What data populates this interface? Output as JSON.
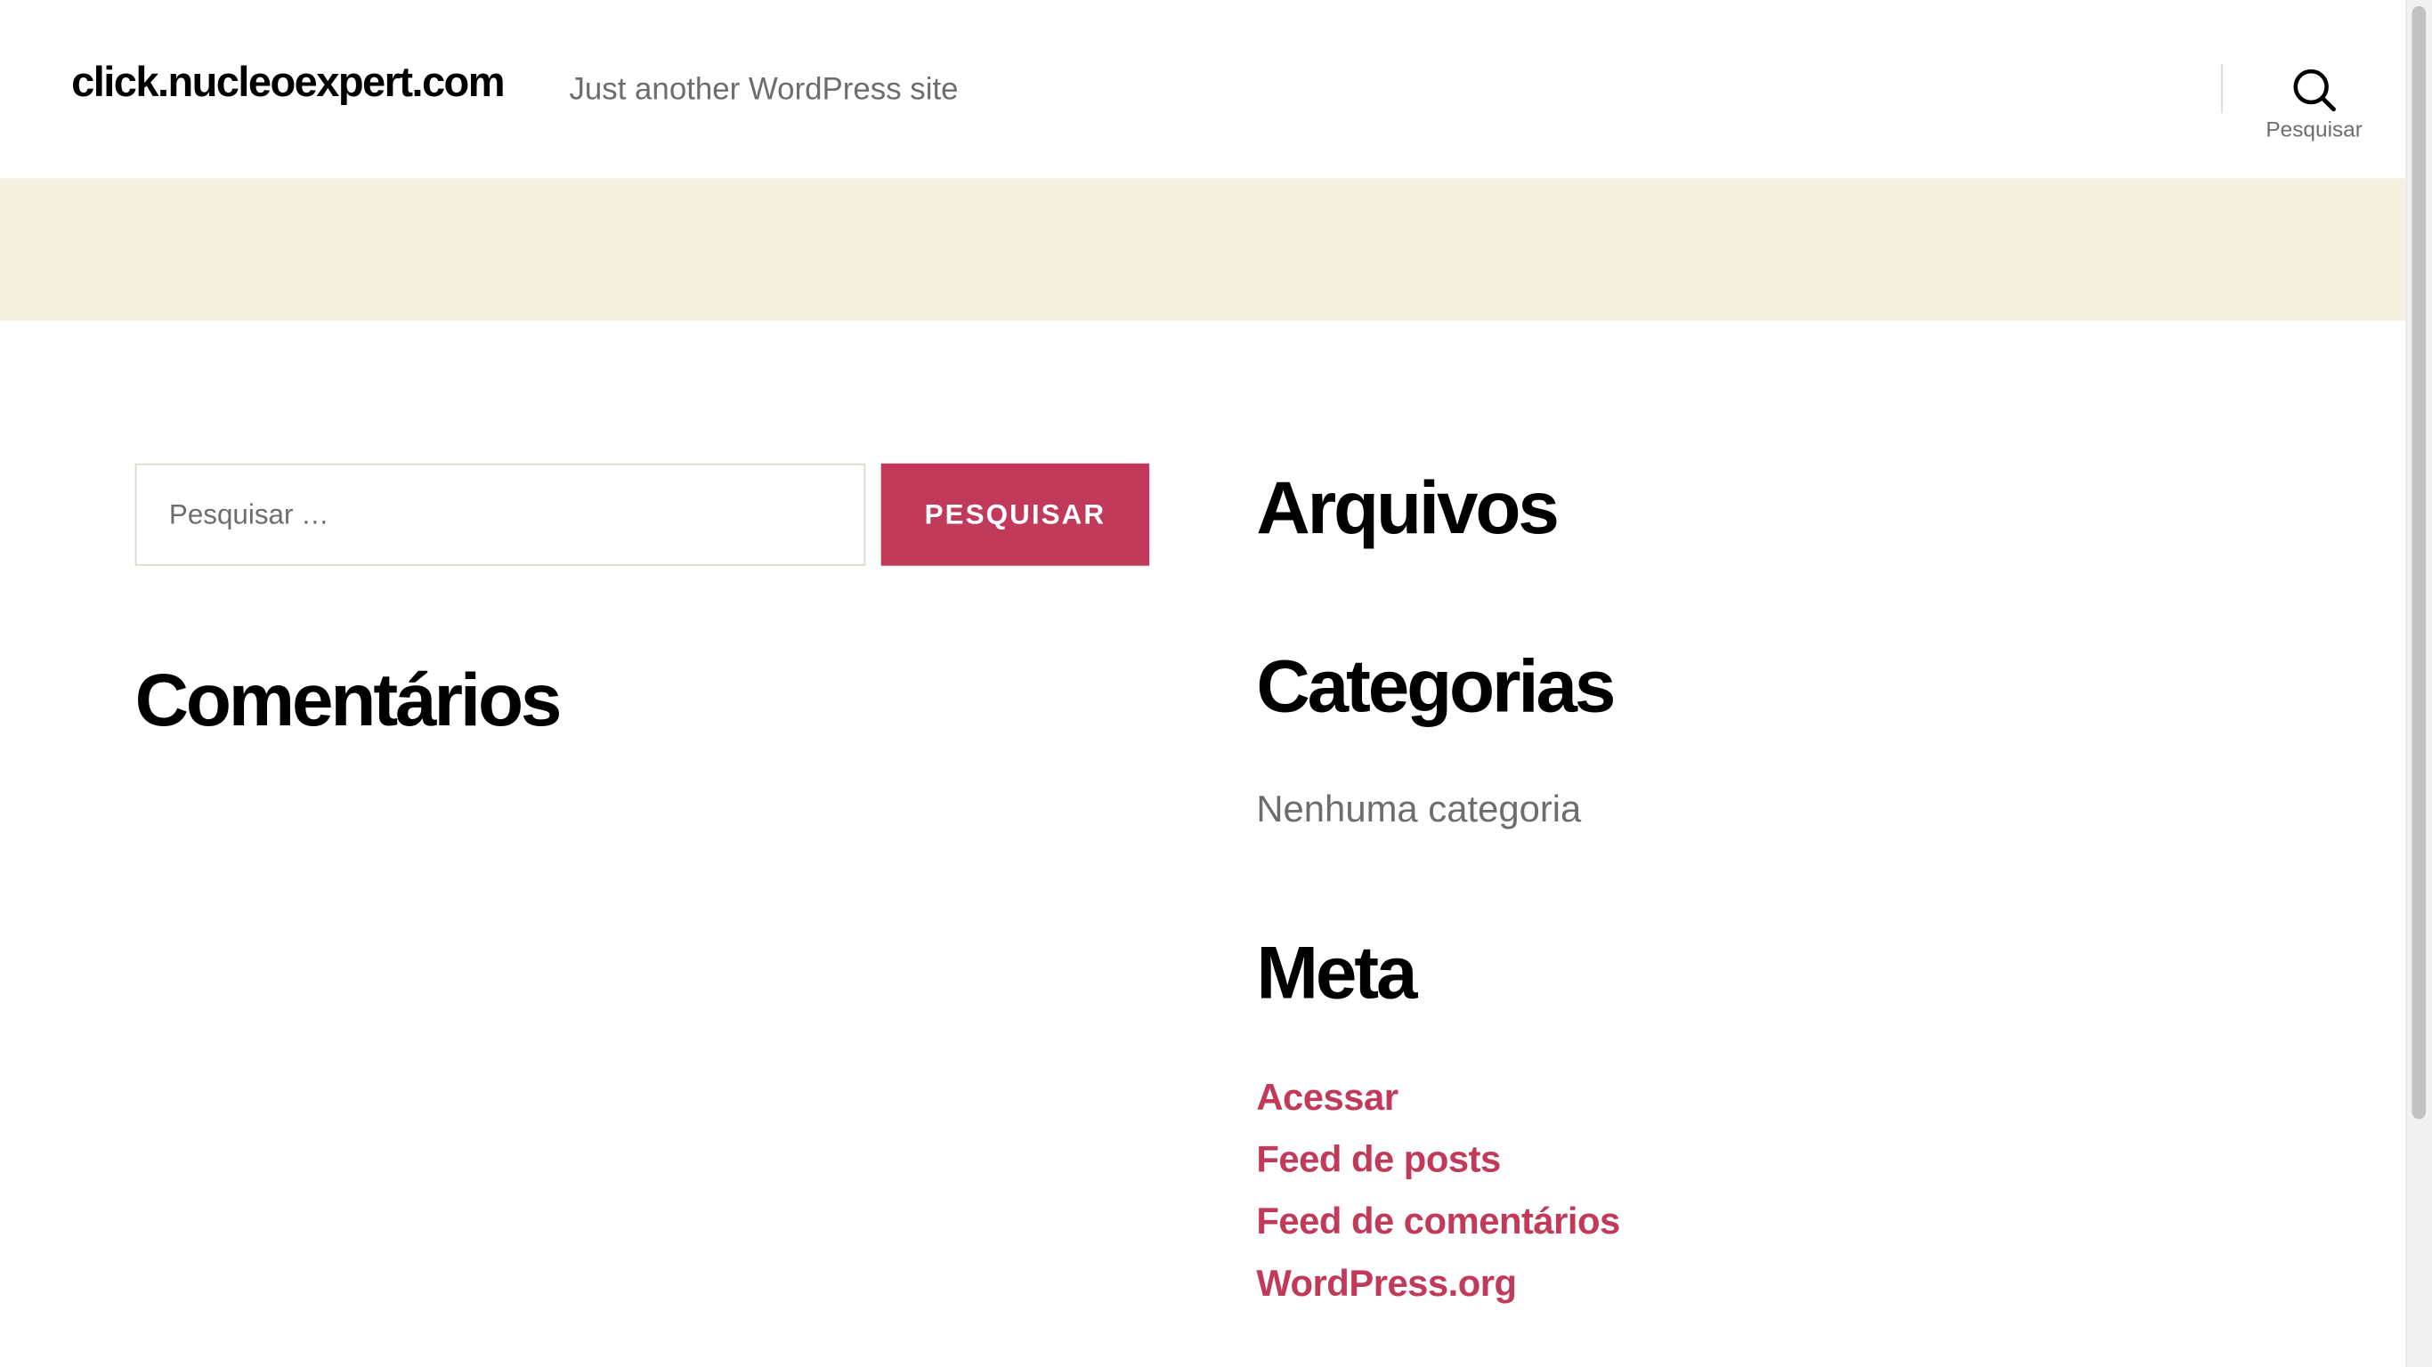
{
  "header": {
    "site_title": "click.nucleoexpert.com",
    "tagline": "Just another WordPress site",
    "search_toggle_label": "Pesquisar"
  },
  "search_widget": {
    "placeholder": "Pesquisar …",
    "value": "",
    "submit_label": "PESQUISAR"
  },
  "widgets": {
    "comments_title": "Comentários",
    "archives_title": "Arquivos",
    "categories_title": "Categorias",
    "no_categories_text": "Nenhuma categoria",
    "meta_title": "Meta",
    "meta_links": [
      {
        "label": "Acessar"
      },
      {
        "label": "Feed de posts"
      },
      {
        "label": "Feed de comentários"
      },
      {
        "label": "WordPress.org"
      }
    ]
  },
  "colors": {
    "accent": "#c13a5a",
    "header_band": "#f5efe0",
    "secondary_text": "#6d6d6d",
    "border": "#dcd7ca"
  },
  "icons": {
    "search_toggle": "search-icon"
  }
}
